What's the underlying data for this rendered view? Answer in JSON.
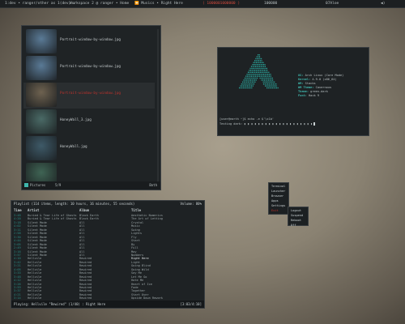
{
  "topbar": {
    "items": [
      {
        "text": "1:dev • ranger/other as 1(dev) ↓",
        "color": "normal"
      },
      {
        "text": "Workspace 2 @ ranger • Home",
        "color": "normal"
      },
      {
        "text": "⏪ Musics • Right Here",
        "color": "normal"
      },
      {
        "text": "⟨ 1000001000000 ⟩",
        "color": "red"
      },
      {
        "text": "100000",
        "color": "normal"
      },
      {
        "text": "07Aloe",
        "color": "normal"
      },
      {
        "text": "◀)",
        "color": "normal"
      }
    ]
  },
  "file_browser": {
    "files": [
      {
        "name": "Portrait-window-by-window.jpg",
        "thumb": "#5a7a96",
        "selected": false
      },
      {
        "name": "Portrait-window-by-window.jpg",
        "thumb": "#5a7a96",
        "selected": false
      },
      {
        "name": "Portrait-window-by-window.jpg",
        "thumb": "#6e6250",
        "selected": true
      },
      {
        "name": "HoneyWall_3.jpg",
        "thumb": "#4a6a66",
        "selected": false
      },
      {
        "name": "HoneyWall.jpg",
        "thumb": "#3e5a68",
        "selected": false
      },
      {
        "name": "",
        "thumb": "#3f6454",
        "selected": false
      }
    ],
    "status_left": "Pictures",
    "status_mid": "5/9",
    "status_right": "Both"
  },
  "terminal": {
    "logo_color": "#2aa89e",
    "info": [
      {
        "k": "OS:",
        "v": "Arch Linux (Core Mode)"
      },
      {
        "k": "Kernel:",
        "v": "4.9.0 (x86_64)"
      },
      {
        "k": "WM:",
        "v": "Stacks"
      },
      {
        "k": "WM Theme:",
        "v": "Cavernous"
      },
      {
        "k": "Theme:",
        "v": "green-dark"
      },
      {
        "k": "Font:",
        "v": "Hack 9"
      }
    ],
    "prompt1": "[user@earth ~]$ echo -e $'\\x1b'",
    "prompt2": "Testing dark: ▮ ▮ ▮ ▮ ▮ ▮ ▮ ▮ ▮ ▮ ▮ ▮ ▮ ▮ ▮ ▮ ▮ ▮ ▮ ▮"
  },
  "music_player": {
    "header": "Playlist (114 items, length: 10 hours, 16 minutes, 55 seconds)",
    "header_right": "Volume: 80%",
    "columns": {
      "time": "Time",
      "artist": "Artist",
      "album": "Album",
      "title": "Title"
    },
    "tracks": [
      {
        "time": "3:48",
        "artist": "Buried & Tear Life of Ghosts",
        "album": "Black Earth",
        "title": "Aesthetic Numerics"
      },
      {
        "time": "4:20",
        "artist": "Buried & Tear Life of Ghosts",
        "album": "Black Earth",
        "title": "The Art of Letting"
      },
      {
        "time": "3:18",
        "artist": "Silent Mode",
        "album": "All",
        "title": "Crystal"
      },
      {
        "time": "4:02",
        "artist": "Silent Mode",
        "album": "All",
        "title": "Music"
      },
      {
        "time": "3:11",
        "artist": "Silent Mode",
        "album": "All",
        "title": "Swing"
      },
      {
        "time": "2:58",
        "artist": "Silent Mode",
        "album": "All",
        "title": "Lights"
      },
      {
        "time": "3:30",
        "artist": "Silent Mode",
        "album": "All",
        "title": "Fly"
      },
      {
        "time": "4:44",
        "artist": "Silent Mode",
        "album": "All",
        "title": "Start"
      },
      {
        "time": "3:05",
        "artist": "Silent Mode",
        "album": "All",
        "title": "By"
      },
      {
        "time": "2:49",
        "artist": "Silent Mode",
        "album": "All",
        "title": "Full"
      },
      {
        "time": "3:16",
        "artist": "Silent Mode",
        "album": "All",
        "title": "May"
      },
      {
        "time": "3:57",
        "artist": "Silent Mode",
        "album": "All",
        "title": "Numbers"
      },
      {
        "time": "4:10",
        "artist": "Hellvile",
        "album": "Rewired",
        "title": "Right Here",
        "hl": true
      },
      {
        "time": "3:42",
        "artist": "Hellvile",
        "album": "Rewired",
        "title": "Light"
      },
      {
        "time": "3:21",
        "artist": "Hellvile",
        "album": "Rewired",
        "title": "Going Blind"
      },
      {
        "time": "4:05",
        "artist": "Hellvile",
        "album": "Rewired",
        "title": "Going Wild"
      },
      {
        "time": "3:33",
        "artist": "Hellvile",
        "album": "Rewired",
        "title": "Say Me"
      },
      {
        "time": "3:48",
        "artist": "Hellvile",
        "album": "Rewired",
        "title": "Let Me Go"
      },
      {
        "time": "4:12",
        "artist": "Hellvile",
        "album": "Rewired",
        "title": "Hate Me"
      },
      {
        "time": "3:26",
        "artist": "Hellvile",
        "album": "Rewired",
        "title": "Heart of Ice"
      },
      {
        "time": "3:59",
        "artist": "Hellvile",
        "album": "Rewired",
        "title": "Fade"
      },
      {
        "time": "3:37",
        "artist": "Hellvile",
        "album": "Rewired",
        "title": "Together"
      },
      {
        "time": "4:21",
        "artist": "Hellvile",
        "album": "Rewired",
        "title": "Start Over"
      },
      {
        "time": "3:14",
        "artist": "Hellvile",
        "album": "Rewired",
        "title": "Upside Down Rework"
      }
    ],
    "status": "Playing: Hellvile \"Rewired\" (1/40) : Right Here",
    "status_right": "[3:03/4:10]"
  },
  "menu1": {
    "items": [
      {
        "label": "Terminal",
        "red": false
      },
      {
        "label": "Launcher",
        "red": false
      },
      {
        "label": "Browser",
        "red": false
      },
      {
        "label": "Apps",
        "red": false
      },
      {
        "label": "Settings",
        "red": false
      },
      {
        "label": "Exit",
        "red": true
      }
    ]
  },
  "menu2": {
    "items": [
      {
        "label": "Logout",
        "red": false
      },
      {
        "label": "Suspend",
        "red": false
      },
      {
        "label": "Reboot",
        "red": false
      },
      {
        "label": "Off",
        "red": false
      }
    ]
  }
}
